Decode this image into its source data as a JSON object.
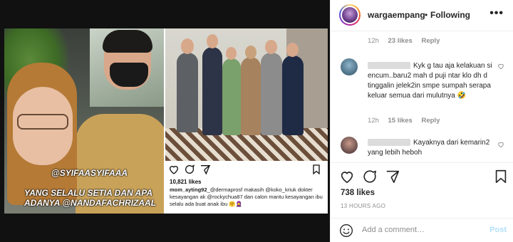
{
  "post_image": {
    "overlay_caption_line1": "@SYIFAASYIFAAA",
    "overlay_caption_line2": "YANG SELALU SETIA DAN APA ADANYA @NANDAFACHRIZAAL",
    "embedded_post": {
      "likes": "10,821 likes",
      "caption_user": "mom_ayting92",
      "caption_text": "_@dermaprosf  makasih @koko_kriuk dokter kesayangan ak @rockychua87 dan calon mantu kesayangan ibu selalu ada buat anak ibu 🤗🧕"
    }
  },
  "header": {
    "username": "wargaempang",
    "dot": "•",
    "follow_label": "Following",
    "more_label": "•••"
  },
  "comments": [
    {
      "time": "12h",
      "likes": "23 likes",
      "reply": "Reply"
    },
    {
      "text": "Kyk g tau aja kelakuan si encum..baru2 mah d puji ntar klo dh d tinggalin jelek2in smpe sumpah serapa keluar semua dari mulutnya 🤣",
      "time": "12h",
      "likes": "15 likes",
      "reply": "Reply"
    },
    {
      "text": "Kayaknya dari kemarin2 yang lebih heboh"
    }
  ],
  "actions": {
    "likes_count": "738 likes",
    "timestamp": "13 HOURS AGO"
  },
  "add_comment": {
    "placeholder": "Add a comment…",
    "post_label": "Post"
  }
}
